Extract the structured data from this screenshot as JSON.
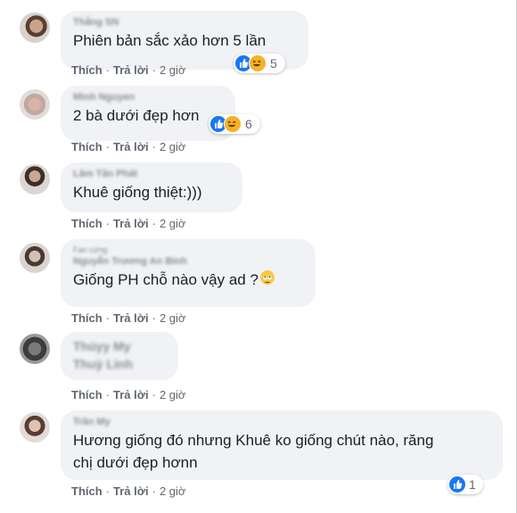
{
  "comments": [
    {
      "name": "Thắng SN",
      "text": "Phiên bản sắc xảo hơn 5 lần",
      "actions": {
        "like": "Thích",
        "reply": "Trả lời",
        "time": "2 giờ"
      },
      "reactions": {
        "types": [
          "like-icon",
          "haha-icon"
        ],
        "count": "5"
      }
    },
    {
      "name": "Minh Nguyen",
      "text": "2 bà dưới đẹp hơn",
      "actions": {
        "like": "Thích",
        "reply": "Trả lời",
        "time": "2 giờ"
      },
      "reactions": {
        "types": [
          "like-icon",
          "haha-icon"
        ],
        "count": "6"
      }
    },
    {
      "name": "Lâm Tấn Phát",
      "text": "Khuê giống thiệt:)))",
      "actions": {
        "like": "Thích",
        "reply": "Trả lời",
        "time": "2 giờ"
      }
    },
    {
      "badge": "Fan cứng",
      "name": "Nguyễn Trương An Bình",
      "text": "Giống PH chỗ nào vậy ad ?",
      "emoji": "rolling-eyes-emoji",
      "actions": {
        "like": "Thích",
        "reply": "Trả lời",
        "time": "2 giờ"
      }
    },
    {
      "name": "Thúyy My",
      "tag": "Thuỳ Linh",
      "actions": {
        "like": "Thích",
        "reply": "Trả lời",
        "time": "2 giờ"
      }
    },
    {
      "name": "Trần My",
      "text_line1": "Hương giống đó nhưng Khuê ko giống chút nào, răng",
      "text_line2": "chị dưới đẹp hơnn",
      "actions": {
        "like": "Thích",
        "reply": "Trả lời",
        "time": "2 giờ"
      },
      "reactions": {
        "types": [
          "like-icon"
        ],
        "count": "1"
      }
    }
  ]
}
